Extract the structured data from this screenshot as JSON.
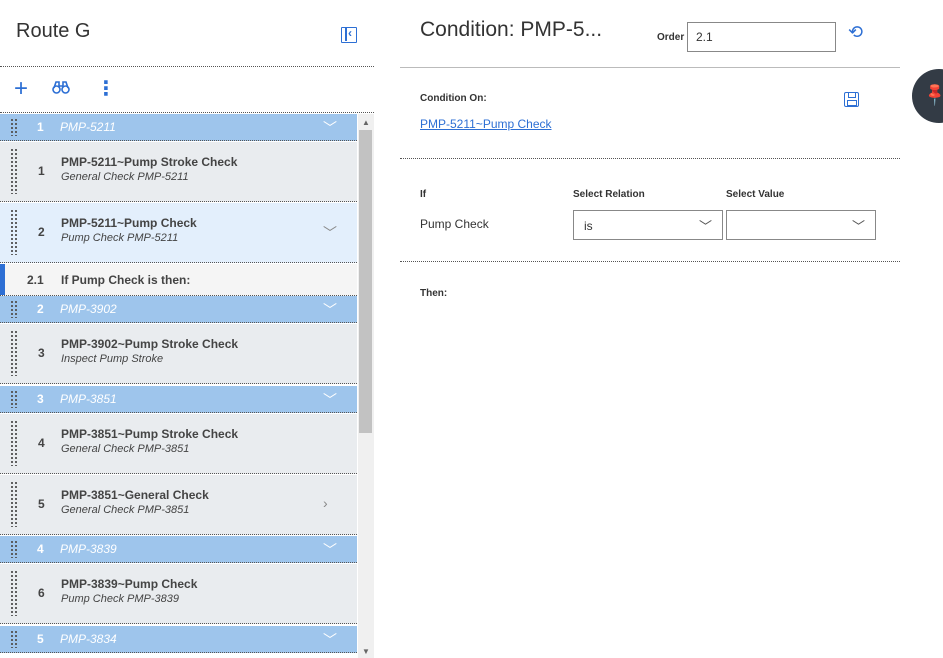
{
  "left_panel": {
    "title": "Route G",
    "groups": [
      {
        "num": "1",
        "name": "PMP-5211"
      },
      {
        "num": "2",
        "name": "PMP-3902"
      },
      {
        "num": "3",
        "name": "PMP-3851"
      },
      {
        "num": "4",
        "name": "PMP-3839"
      },
      {
        "num": "5",
        "name": "PMP-3834"
      }
    ],
    "items": [
      {
        "num": "1",
        "title": "PMP-5211~Pump Stroke Check",
        "subtitle": "General Check PMP-5211"
      },
      {
        "num": "2",
        "title": "PMP-5211~Pump Check",
        "subtitle": "Pump Check PMP-5211"
      },
      {
        "num": "3",
        "title": "PMP-3902~Pump Stroke Check",
        "subtitle": "Inspect Pump Stroke"
      },
      {
        "num": "4",
        "title": "PMP-3851~Pump Stroke Check",
        "subtitle": "General Check PMP-3851"
      },
      {
        "num": "5",
        "title": "PMP-3851~General Check",
        "subtitle": "General Check PMP-3851"
      },
      {
        "num": "6",
        "title": "PMP-3839~Pump Check",
        "subtitle": "Pump Check PMP-3839"
      }
    ],
    "condition_row": {
      "num": "2.1",
      "text": "If Pump Check is then:"
    }
  },
  "right_panel": {
    "title": "Condition: PMP-5...",
    "order_label": "Order",
    "order_value": "2.1",
    "condition_on_label": "Condition On:",
    "condition_on_link": "PMP-5211~Pump Check",
    "if_label": "If",
    "relation_label": "Select Relation",
    "value_label": "Select Value",
    "if_field": "Pump Check",
    "relation_value": "is",
    "select_value": "",
    "then_label": "Then:"
  },
  "colors": {
    "accent": "#2d6fd4",
    "group_header": "#9ec5ec",
    "selected_row": "#e3effc"
  },
  "icons": [
    "collapse-panel-icon",
    "plus-icon",
    "binoculars-icon",
    "more-vertical-icon",
    "chevron-down-icon",
    "chevron-right-icon",
    "refresh-icon",
    "save-icon",
    "pin-icon"
  ]
}
